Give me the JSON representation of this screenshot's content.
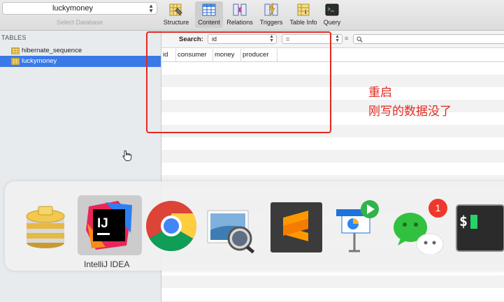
{
  "toolbar": {
    "database_select": "luckymoney",
    "database_caption": "Select Database",
    "tools": [
      {
        "label": "Structure",
        "icon": "structure-icon"
      },
      {
        "label": "Content",
        "icon": "content-icon",
        "active": true
      },
      {
        "label": "Relations",
        "icon": "relations-icon"
      },
      {
        "label": "Triggers",
        "icon": "triggers-icon"
      },
      {
        "label": "Table Info",
        "icon": "table-info-icon"
      },
      {
        "label": "Query",
        "icon": "query-icon"
      }
    ]
  },
  "sidebar": {
    "header": "TABLES",
    "tables": [
      {
        "name": "hibernate_sequence",
        "selected": false
      },
      {
        "name": "luckymoney",
        "selected": true
      }
    ]
  },
  "filter": {
    "search_label": "Search:",
    "field": "id",
    "operator": "=",
    "value": ""
  },
  "columns": [
    "id",
    "consumer",
    "money",
    "producer"
  ],
  "annotation": {
    "line1": "重启",
    "line2": "刚写的数据没了",
    "color": "#e12a22"
  },
  "dock": {
    "hover_label": "IntelliJ IDEA",
    "apps": [
      "sequel-pro-icon",
      "intellij-idea-icon",
      "chrome-icon",
      "preview-icon",
      "sublime-text-icon",
      "keynote-icon",
      "wechat-icon",
      "terminal-icon"
    ],
    "wechat_badge": "1"
  }
}
